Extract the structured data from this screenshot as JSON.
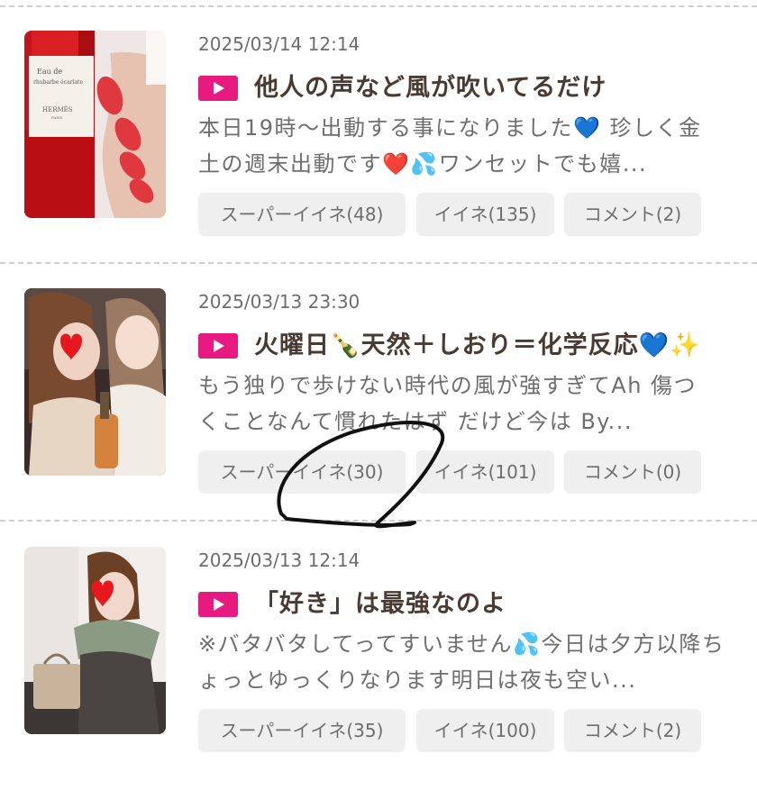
{
  "posts": [
    {
      "date": "2025/03/14 12:14",
      "title": "他人の声など風が吹いてるだけ",
      "excerpt_line1": "本日19時〜出動する事になりました💙 珍しく金",
      "excerpt_line2": "土の週末出動です❤️💦ワンセットでも嬉...",
      "super_like": "スーパーイイネ(48)",
      "like": "イイネ(135)",
      "comment": "コメント(2)",
      "photo_text1": "Eau de",
      "photo_text2": "rhubarbe écarlate",
      "photo_text3": "HERMÈS",
      "photo_text4": "PARIS"
    },
    {
      "date": "2025/03/13 23:30",
      "title": "火曜日🍾天然＋しおり＝化学反応💙✨",
      "excerpt_line1": " もう独りで歩けない時代の風が強すぎてAh 傷つ",
      "excerpt_line2": "くことなんて慣れたはず だけど今は By...",
      "super_like": "スーパーイイネ(30)",
      "like": "イイネ(101)",
      "comment": "コメント(0)"
    },
    {
      "date": "2025/03/13 12:14",
      "title": "「好き」は最強なのよ",
      "excerpt_line1": "※バタバタしてってすいません💦今日は夕方以降ち",
      "excerpt_line2": "ょっとゆっくりなります明日は夜も空い...",
      "super_like": "スーパーイイネ(35)",
      "like": "イイネ(100)",
      "comment": "コメント(2)"
    }
  ],
  "colors": {
    "play_badge": "#e8197f",
    "title_text": "#4a3b32",
    "button_bg": "#efefef"
  }
}
